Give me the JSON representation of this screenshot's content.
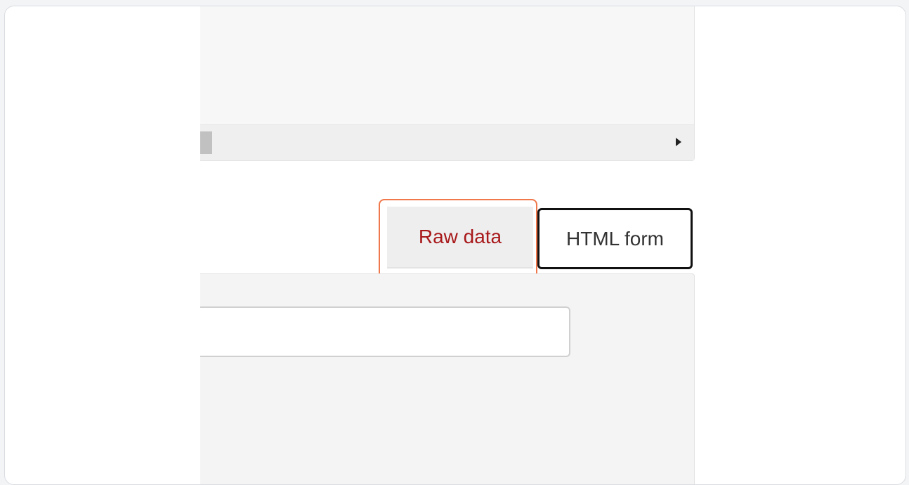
{
  "tabs": {
    "raw_label": "Raw data",
    "html_label": "HTML form",
    "active": "raw"
  },
  "form": {
    "input_value": "",
    "input_placeholder": ""
  },
  "colors": {
    "active_tab_text": "#a8191b",
    "highlight": "#f0784b"
  },
  "icons": {
    "scroll_right": "triangle-right-icon"
  }
}
